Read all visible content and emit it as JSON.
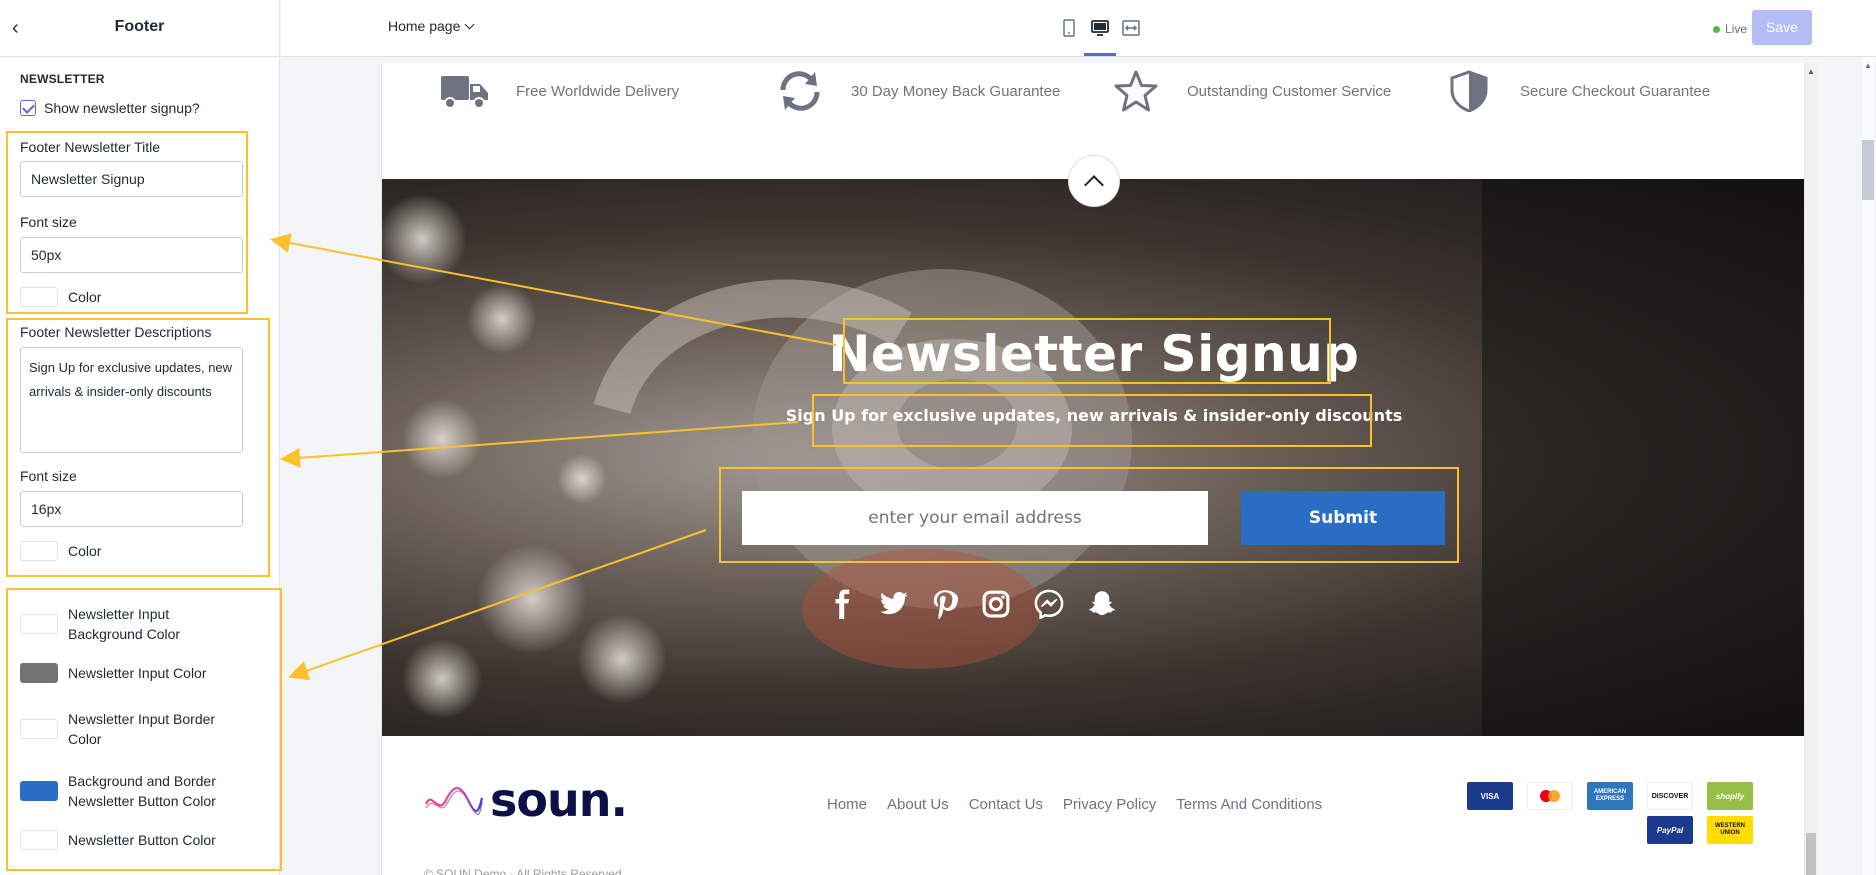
{
  "panel": {
    "title": "Footer",
    "section": "NEWSLETTER",
    "show_signup_label": "Show newsletter signup?",
    "title_label": "Footer Newsletter Title",
    "title_value": "Newsletter Signup",
    "font_size_label": "Font size",
    "title_font_size": "50px",
    "color_label": "Color",
    "desc_label": "Footer Newsletter Descriptions",
    "desc_value": "Sign Up for exclusive updates, new arrivals & insider-only discounts",
    "desc_font_size": "16px",
    "input_bg_label": "Newsletter Input Background Color",
    "input_color_label": "Newsletter Input Color",
    "input_border_label": "Newsletter Input Border Color",
    "btn_bg_label": "Background and Border Newsletter Button Color",
    "btn_color_label": "Newsletter Button Color"
  },
  "topbar": {
    "page_select": "Home page",
    "live": "Live",
    "save": "Save"
  },
  "preview": {
    "features": [
      "Free Worldwide Delivery",
      "30 Day Money Back Guarantee",
      "Outstanding Customer Service",
      "Secure Checkout Guarantee"
    ],
    "newsletter_title": "Newsletter Signup",
    "newsletter_desc": "Sign Up for exclusive updates, new arrivals & insider-only discounts",
    "email_placeholder": "enter your email address",
    "submit": "Submit",
    "social_icons": [
      "facebook-icon",
      "twitter-icon",
      "pinterest-icon",
      "instagram-icon",
      "messenger-icon",
      "snapchat-icon"
    ],
    "brand": "soun.",
    "footer_links": [
      "Home",
      "About Us",
      "Contact Us",
      "Privacy Policy",
      "Terms And Conditions"
    ],
    "payments": [
      "VISA",
      "MasterCard",
      "AMERICAN EXPRESS",
      "DISCOVER",
      "shopify",
      "PayPal",
      "WESTERN UNION"
    ],
    "copyright": "© SOUN Demo - All Rights Reserved"
  },
  "colors": {
    "accent": "#5c6ac4",
    "highlight": "#fbc02d",
    "button_blue": "#2b6cc4",
    "input_grey": "#737373"
  }
}
